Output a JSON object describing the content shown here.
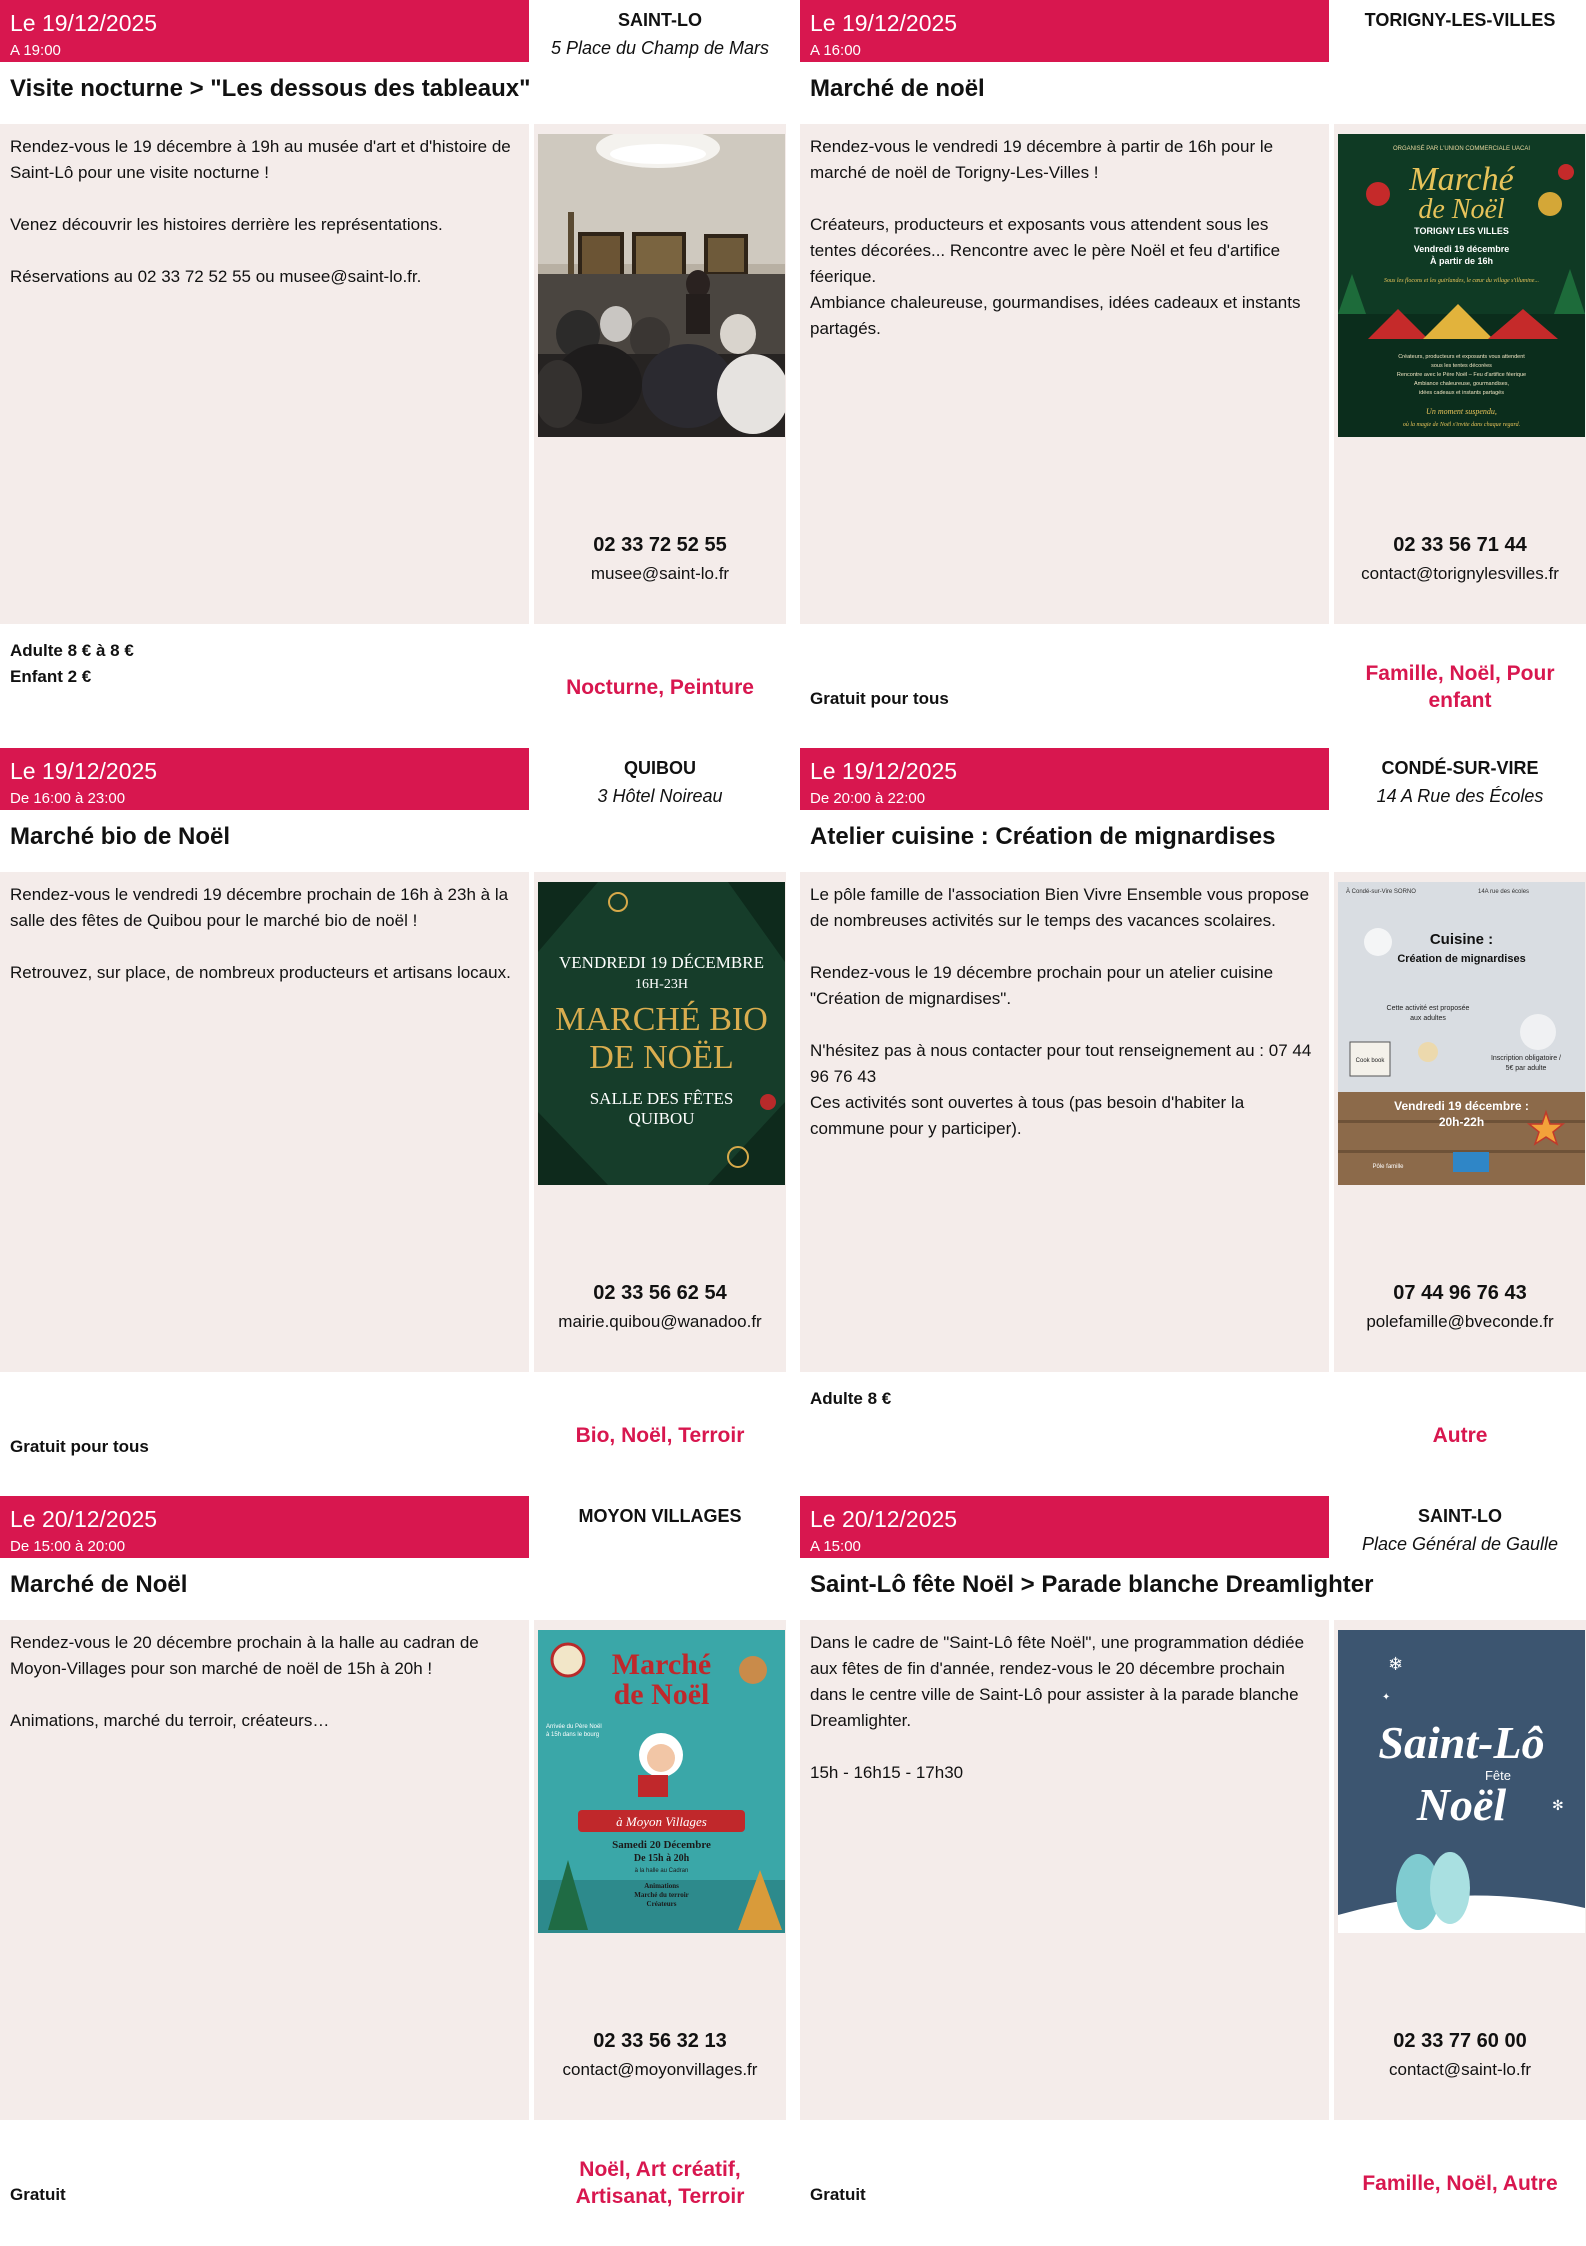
{
  "events": [
    {
      "date": "Le 19/12/2025",
      "time": "A 19:00",
      "title": "Visite nocturne > \"Les dessous des tableaux\"",
      "town": "SAINT-LO",
      "address": "5 Place du Champ de Mars",
      "description": [
        "Rendez-vous le 19 décembre à 19h au musée d'art et d'histoire de Saint-Lô pour une visite nocturne !",
        "Venez découvrir les histoires derrière les représentations.",
        "Réservations au 02 33 72 52 55 ou musee@saint-lo.fr."
      ],
      "phone": "02 33 72 52 55",
      "email": "musee@saint-lo.fr",
      "price_lines": [
        "Adulte 8 € à 8 €",
        "Enfant 2 €"
      ],
      "tags": [
        "Nocturne, Peinture"
      ],
      "image": "museum-visit-photo"
    },
    {
      "date": "Le 19/12/2025",
      "time": "A 16:00",
      "title": "Marché de noël",
      "town": "TORIGNY-LES-VILLES",
      "address": "",
      "description": [
        "Rendez-vous le vendredi 19 décembre à partir de 16h pour le marché de noël de Torigny-Les-Villes !",
        "Créateurs, producteurs et exposants vous attendent sous les tentes décorées... Rencontre avec le père Noël et feu d'artifice féerique.",
        "Ambiance chaleureuse, gourmandises, idées cadeaux et instants partagés."
      ],
      "phone": "02 33 56 71 44",
      "email": "contact@torignylesvilles.fr",
      "price_lines": [
        "Gratuit pour tous"
      ],
      "tags": [
        "Famille, Noël, Pour",
        "enfant"
      ],
      "image": "christmas-market-poster",
      "poster_text": {
        "organizer": "ORGANISÉ PAR L'UNION COMMERCIALE UACAI",
        "headline_1": "Marché",
        "headline_2": "de Noël",
        "place": "TORIGNY LES VILLES",
        "when_1": "Vendredi 19 décembre",
        "when_2": "À partir de 16h",
        "tagline": "Sous les flocons et les guirlandes, le cœur du village s'illumine...",
        "info_1": "Créateurs, producteurs et exposants vous attendent",
        "info_2": "sous les tentes décorées",
        "info_3": "Rencontre avec le Père Noël – Feu d'artifice féerique",
        "info_4": "Ambiance chaleureuse, gourmandises,",
        "info_5": "idées cadeaux et instants partagés",
        "closing_1": "Un moment suspendu,",
        "closing_2": "où la magie de Noël s'invite dans chaque regard."
      }
    },
    {
      "date": "Le 19/12/2025",
      "time": "De 16:00 à 23:00",
      "title": "Marché bio de Noël",
      "town": "QUIBOU",
      "address": "3 Hôtel Noireau",
      "description": [
        "Rendez-vous le vendredi 19 décembre prochain de 16h à 23h à la salle des fêtes de Quibou pour le marché bio de noël !",
        "Retrouvez, sur place, de nombreux producteurs et artisans locaux."
      ],
      "phone": "02 33 56 62 54",
      "email": "mairie.quibou@wanadoo.fr",
      "price_lines": [
        "Gratuit pour tous"
      ],
      "tags": [
        "Bio, Noël, Terroir"
      ],
      "image": "organic-market-poster",
      "poster_text": {
        "day": "VENDREDI 19 DÉCEMBRE",
        "hours": "16H-23H",
        "headline_1": "MARCHÉ BIO",
        "headline_2": "DE NOËL",
        "venue_1": "SALLE DES FÊTES",
        "venue_2": "QUIBOU"
      }
    },
    {
      "date": "Le 19/12/2025",
      "time": "De 20:00 à 22:00",
      "title": "Atelier cuisine : Création de mignardises",
      "town": "CONDÉ-SUR-VIRE",
      "address": "14 A Rue des Écoles",
      "description": [
        "Le pôle famille de l'association Bien Vivre Ensemble vous propose de nombreuses activités sur le temps des vacances scolaires.",
        "Rendez-vous le 19 décembre prochain pour un atelier cuisine \"Création de mignardises\".",
        "N'hésitez pas à nous contacter pour tout renseignement au : 07 44 96 76 43",
        "Ces activités sont ouvertes à tous (pas besoin d'habiter la commune pour y participer)."
      ],
      "phone": "07 44 96 76 43",
      "email": "polefamille@bveconde.fr",
      "price_lines": [
        "Adulte 8 €"
      ],
      "tags": [
        "Autre"
      ],
      "image": "cooking-workshop-poster",
      "poster_text": {
        "top_left": "À Condé-sur-Vire SORNO",
        "top_right": "14A rue des écoles",
        "headline_1": "Cuisine :",
        "headline_2": "Création de mignardises",
        "note_1": "Cette activité est proposée",
        "note_2": "aux adultes",
        "signup_1": "Inscription obligatoire /",
        "signup_2": "5€ par adulte",
        "book": "Cook book",
        "when_1": "Vendredi 19 décembre :",
        "when_2": "20h-22h",
        "footer": "Pôle famille"
      }
    },
    {
      "date": "Le 20/12/2025",
      "time": "De 15:00 à 20:00",
      "title": "Marché de Noël",
      "town": "MOYON VILLAGES",
      "address": "",
      "description": [
        "Rendez-vous le 20 décembre prochain à la halle au cadran de Moyon-Villages pour son marché de noël de 15h à 20h !",
        "Animations, marché du terroir, créateurs…"
      ],
      "phone": "02 33 56 32 13",
      "email": "contact@moyonvillages.fr",
      "price_lines": [
        "Gratuit"
      ],
      "tags": [
        "Noël, Art créatif,",
        "Artisanat, Terroir"
      ],
      "image": "village-christmas-market-poster",
      "poster_text": {
        "headline_1": "Marché",
        "headline_2": "de Noël",
        "side_1": "Arrivée du Père Noël",
        "side_2": "à 15h dans le bourg",
        "ribbon": "à Moyon Villages",
        "when_1": "Samedi 20 Décembre",
        "when_2": "De 15h à 20h",
        "where": "à la halle au Cadran",
        "list_1": "Animations",
        "list_2": "Marché du terroir",
        "list_3": "Créateurs"
      }
    },
    {
      "date": "Le 20/12/2025",
      "time": "A 15:00",
      "title": "Saint-Lô fête Noël > Parade blanche Dreamlighter",
      "town": "SAINT-LO",
      "address": "Place Général de Gaulle",
      "description": [
        "Dans le cadre de \"Saint-Lô fête Noël\", une programmation dédiée aux fêtes de fin d'année, rendez-vous le 20 décembre prochain dans le centre ville de Saint-Lô pour assister à la parade blanche Dreamlighter.",
        "15h - 16h15 - 17h30"
      ],
      "phone": "02 33 77 60 00",
      "email": "contact@saint-lo.fr",
      "price_lines": [
        "Gratuit"
      ],
      "tags": [
        "Famille, Noël, Autre"
      ],
      "image": "saint-lo-fete-noel-poster",
      "poster_text": {
        "headline_1": "Saint-Lô",
        "headline_2": "Fête",
        "headline_3": "Noël"
      }
    }
  ],
  "colors": {
    "accent": "#d8174f",
    "panel": "#f4ecea"
  }
}
